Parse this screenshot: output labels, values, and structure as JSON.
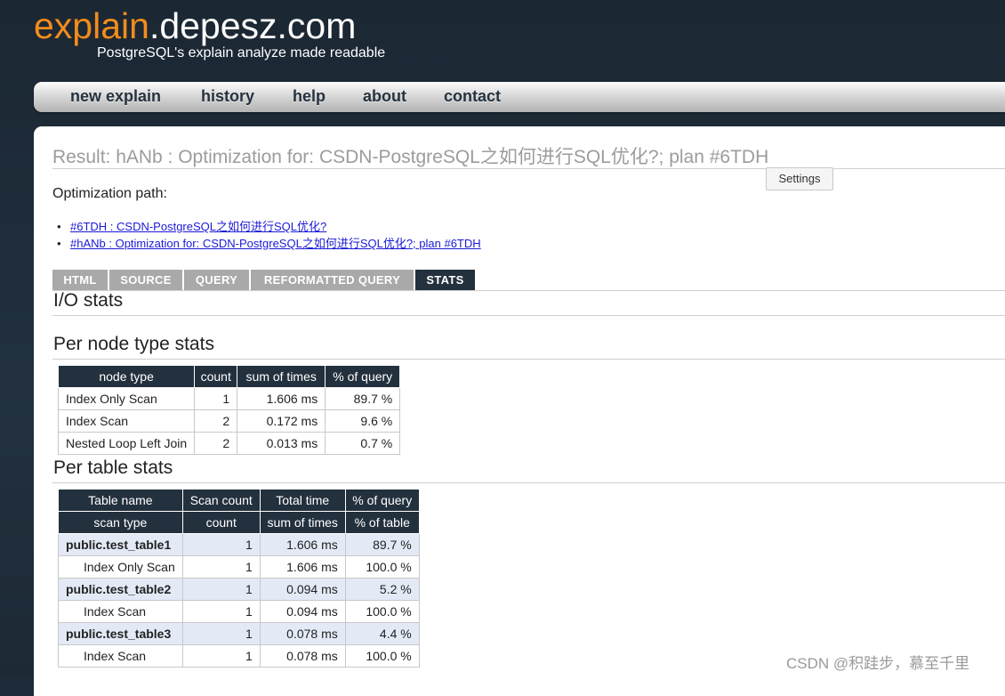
{
  "header": {
    "logo_part1": "explain",
    "logo_part2": ".depesz.com",
    "tagline": "PostgreSQL's explain analyze made readable"
  },
  "menu": {
    "items": [
      {
        "label": "new explain"
      },
      {
        "label": "history"
      },
      {
        "label": "help"
      },
      {
        "label": "about"
      },
      {
        "label": "contact"
      }
    ]
  },
  "page": {
    "title": "Result: hANb : Optimization for: CSDN-PostgreSQL之如何进行SQL优化?; plan #6TDH",
    "settings_label": "Settings",
    "optimization_path_label": "Optimization path:",
    "path_links": [
      {
        "text": "#6TDH : CSDN-PostgreSQL之如何进行SQL优化?"
      },
      {
        "text": "#hANb : Optimization for: CSDN-PostgreSQL之如何进行SQL优化?; plan #6TDH"
      }
    ]
  },
  "tabs": [
    {
      "label": "HTML",
      "active": false
    },
    {
      "label": "SOURCE",
      "active": false
    },
    {
      "label": "QUERY",
      "active": false
    },
    {
      "label": "REFORMATTED QUERY",
      "active": false
    },
    {
      "label": "STATS",
      "active": true
    }
  ],
  "stats": {
    "io_heading": "I/O stats",
    "node_heading": "Per node type stats",
    "node_table": {
      "headers": [
        "node type",
        "count",
        "sum of times",
        "% of query"
      ],
      "rows": [
        [
          "Index Only Scan",
          "1",
          "1.606 ms",
          "89.7 %"
        ],
        [
          "Index Scan",
          "2",
          "0.172 ms",
          "9.6 %"
        ],
        [
          "Nested Loop Left Join",
          "2",
          "0.013 ms",
          "0.7 %"
        ]
      ]
    },
    "table_heading": "Per table stats",
    "table_table": {
      "headers1": [
        "Table name",
        "Scan count",
        "Total time",
        "% of query"
      ],
      "headers2": [
        "scan type",
        "count",
        "sum of times",
        "% of table"
      ],
      "rows": [
        [
          "public.test_table1",
          "1",
          "1.606 ms",
          "89.7 %"
        ],
        [
          "Index Only Scan",
          "1",
          "1.606 ms",
          "100.0 %"
        ],
        [
          "public.test_table2",
          "1",
          "0.094 ms",
          "5.2 %"
        ],
        [
          "Index Scan",
          "1",
          "0.094 ms",
          "100.0 %"
        ],
        [
          "public.test_table3",
          "1",
          "0.078 ms",
          "4.4 %"
        ],
        [
          "Index Scan",
          "1",
          "0.078 ms",
          "100.0 %"
        ]
      ]
    }
  },
  "watermark": "CSDN @积跬步，慕至千里",
  "colors": {
    "logo_accent": "#f28c1b",
    "header_bg": "#1e2b38",
    "table_header_bg": "#23303d",
    "table_row_highlight": "#e3eaf6",
    "link": "#1a1ad6"
  }
}
